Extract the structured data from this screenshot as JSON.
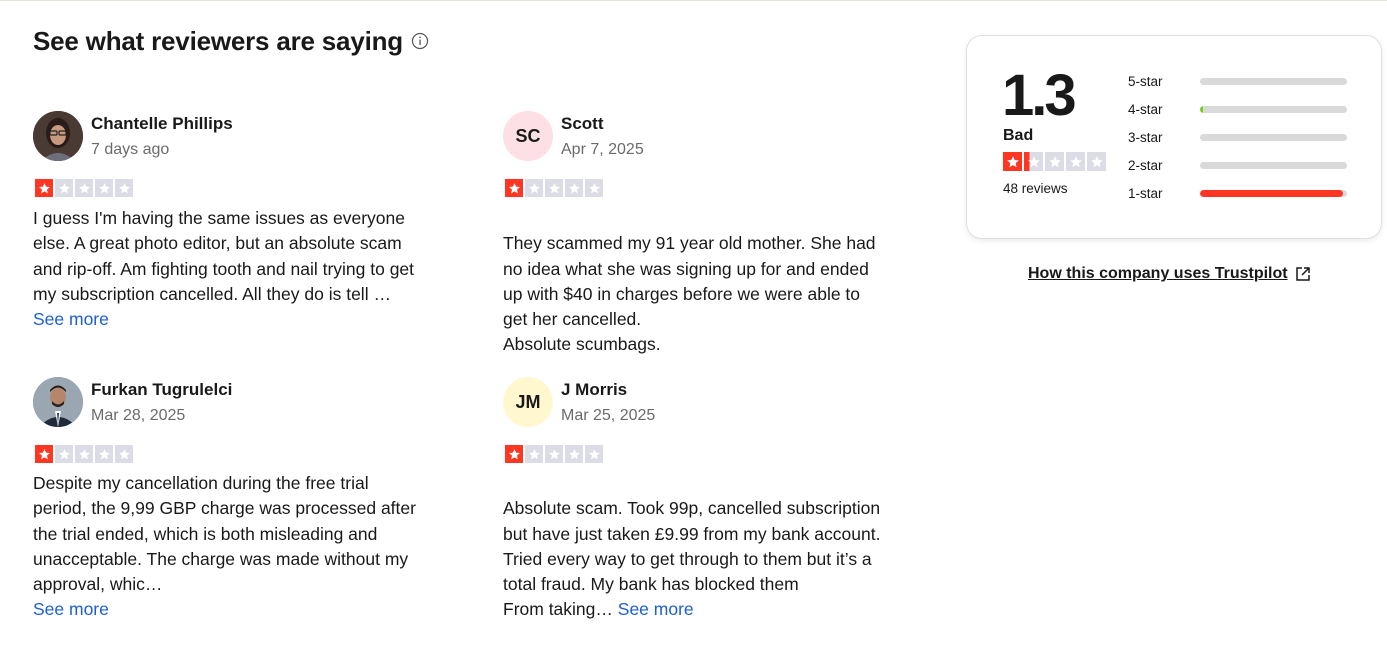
{
  "section": {
    "title": "See what reviewers are saying",
    "info_icon": "info-circle-icon"
  },
  "reviews": [
    {
      "name": "Chantelle Phillips",
      "date": "7 days ago",
      "initials": "",
      "avatar": "photo",
      "rating": 1,
      "body": "I guess I'm having the same issues as everyone else. A great photo editor, but an absolute scam and rip-off. Am fighting tooth and nail trying to get my subscription cancelled. All they do is tell …",
      "see_more": "See more"
    },
    {
      "name": "Scott",
      "date": "Apr 7, 2025",
      "initials": "SC",
      "avatar_color": "#fde0e6",
      "rating": 1,
      "body": "They scammed my 91 year old mother. She had no idea what she was signing up for and ended up with $40 in charges before we were able to get her cancelled.\nAbsolute scumbags.",
      "see_more": ""
    },
    {
      "name": "Furkan Tugrulelci",
      "date": "Mar 28, 2025",
      "initials": "",
      "avatar": "photo",
      "rating": 1,
      "body": "Despite my cancellation during the free trial period, the 9,99 GBP charge was processed after the trial ended, which is both misleading and unacceptable. The charge was made without my approval, whic…",
      "see_more": "See more"
    },
    {
      "name": "J Morris",
      "date": "Mar 25, 2025",
      "initials": "JM",
      "avatar_color": "#fff8cf",
      "rating": 1,
      "body": "Absolute scam. Took 99p, cancelled subscription but have just taken £9.99 from my bank account. Tried every way to get through to them but it’s a total fraud. My bank has blocked them\nFrom taking…",
      "see_more": "See more"
    }
  ],
  "summary": {
    "score": "1.3",
    "verdict": "Bad",
    "rating_stars": 1.3,
    "reviews_count": "48 reviews",
    "distribution": [
      {
        "label": "5-star",
        "fraction": 0.0,
        "color": "#d9d9d9"
      },
      {
        "label": "4-star",
        "fraction": 0.02,
        "color": "#73cf11"
      },
      {
        "label": "3-star",
        "fraction": 0.0,
        "color": "#d9d9d9"
      },
      {
        "label": "2-star",
        "fraction": 0.0,
        "color": "#d9d9d9"
      },
      {
        "label": "1-star",
        "fraction": 0.97,
        "color": "#ff3722"
      }
    ]
  },
  "trust_link": {
    "label": "How this company uses Trustpilot",
    "icon": "external-link-icon"
  },
  "colors": {
    "star_red": "#ff3722",
    "star_empty": "#dcdce6",
    "link_blue": "#1d5fd2"
  }
}
